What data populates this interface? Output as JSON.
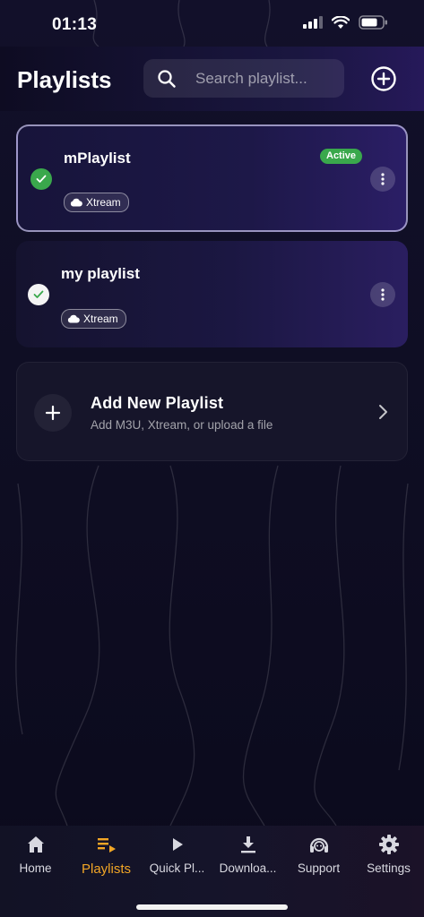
{
  "status_bar": {
    "time": "01:13"
  },
  "header": {
    "title": "Playlists",
    "search_placeholder": "Search playlist..."
  },
  "playlists": [
    {
      "name": "mPlaylist",
      "type": "Xtream",
      "badge": "Active",
      "selected": true
    },
    {
      "name": "my playlist",
      "type": "Xtream",
      "badge": "",
      "selected": true
    }
  ],
  "add_card": {
    "title": "Add New Playlist",
    "subtitle": "Add M3U, Xtream, or upload a file"
  },
  "tabs": [
    {
      "label": "Home",
      "icon": "home-icon"
    },
    {
      "label": "Playlists",
      "icon": "playlist-icon",
      "active": true
    },
    {
      "label": "Quick Pl...",
      "icon": "play-icon"
    },
    {
      "label": "Downloa...",
      "icon": "download-icon"
    },
    {
      "label": "Support",
      "icon": "headset-icon"
    },
    {
      "label": "Settings",
      "icon": "gear-icon"
    }
  ],
  "colors": {
    "accent": "#f2a626",
    "active_green": "#3aa84c",
    "background": "#12102a"
  }
}
